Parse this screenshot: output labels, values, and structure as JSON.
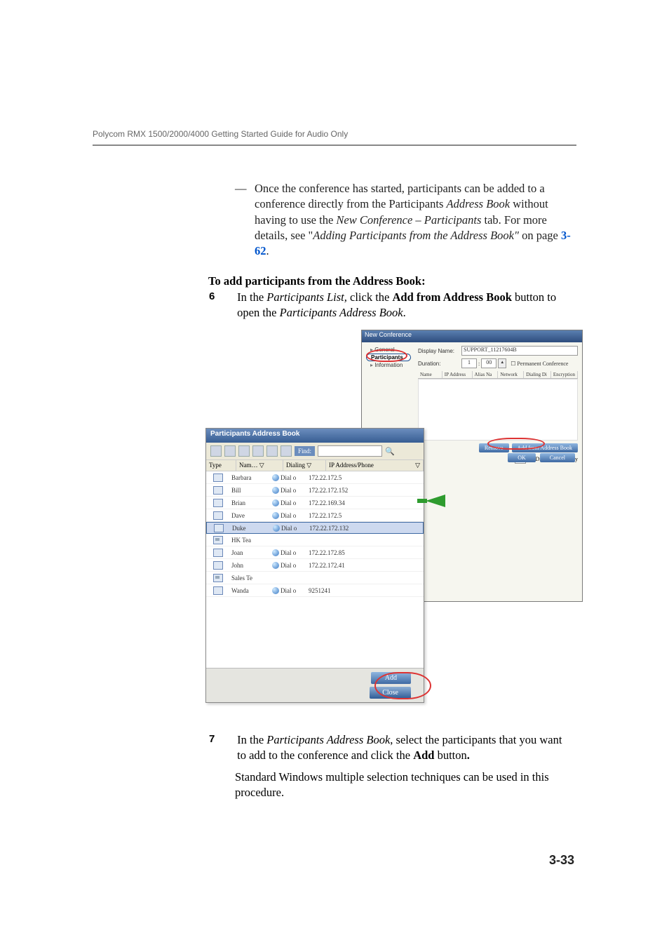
{
  "header": {
    "running": "Polycom RMX 1500/2000/4000 Getting Started Guide for Audio Only"
  },
  "bullet": {
    "text": "Once the conference has started, participants can be added to a conference directly from the Participants ",
    "em1": "Address Book",
    "text2": " without having to use the ",
    "em2": "New Conference – Participants",
    "text3": " tab. For more details, see \"",
    "em3": "Adding Participants from the Address Book\"",
    "text4": " on page ",
    "link": "3-62",
    "tail": "."
  },
  "subhead": "To add participants from the Address Book:",
  "step6": {
    "no": "6",
    "a": "In the ",
    "em1": "Participants List,",
    "b": " click the ",
    "strong": "Add from Address Book",
    "c": " button to open the ",
    "em2": "Participants Address Book",
    "tail": "."
  },
  "step7": {
    "no": "7",
    "a": "In the ",
    "em1": "Participants Address Book",
    "b": ", select the participants that you want to add to the conference and click the ",
    "strong": "Add",
    "c": " button",
    "tail": "."
  },
  "para2": "Standard Windows multiple selection techniques can be used in this procedure.",
  "pagenum": "3-33",
  "dialog": {
    "title": "New Conference",
    "nav": {
      "general": "General",
      "participants": "Participants",
      "information": "Information"
    },
    "form": {
      "displayName_lab": "Display Name:",
      "displayName_val": "SUPPORT_11217604B",
      "duration_lab": "Duration:",
      "dur_h": "1",
      "dur_m": "00",
      "permconf": "Permanent Conference",
      "hdr_name": "Name",
      "hdr_ip": "IP Address",
      "hdr_alias": "Alias Na",
      "hdr_net": "Network",
      "hdr_dial": "Dialing Di",
      "hdr_enc": "Encryption",
      "remove": "Remove",
      "addbook": "Add from Address Book",
      "dom": "Dial Out Manually",
      "ok": "OK",
      "cancel": "Cancel"
    }
  },
  "pab": {
    "title": "Participants Address Book",
    "find": "Find:",
    "hdr_type": "Type",
    "hdr_name": "Nam…",
    "hdr_dial": "Dialing",
    "hdr_ip": "IP Address/Phone",
    "rows": [
      {
        "name": "Barbara",
        "dial": "Dial o",
        "ip": "172.22.172.5"
      },
      {
        "name": "Bill",
        "dial": "Dial o",
        "ip": "172.22.172.152"
      },
      {
        "name": "Brian",
        "dial": "Dial o",
        "ip": "172.22.169.34"
      },
      {
        "name": "Dave",
        "dial": "Dial o",
        "ip": "172.22.172.5"
      },
      {
        "name": "Duke",
        "dial": "Dial o",
        "ip": "172.22.172.132",
        "selected": true
      },
      {
        "name": "HK Tea",
        "group": true
      },
      {
        "name": "Joan",
        "dial": "Dial o",
        "ip": "172.22.172.85"
      },
      {
        "name": "John",
        "dial": "Dial o",
        "ip": "172.22.172.41"
      },
      {
        "name": "Sales Te",
        "group": true
      },
      {
        "name": "Wanda",
        "dial": "Dial o",
        "ip": "9251241"
      }
    ],
    "add": "Add",
    "close": "Close"
  }
}
